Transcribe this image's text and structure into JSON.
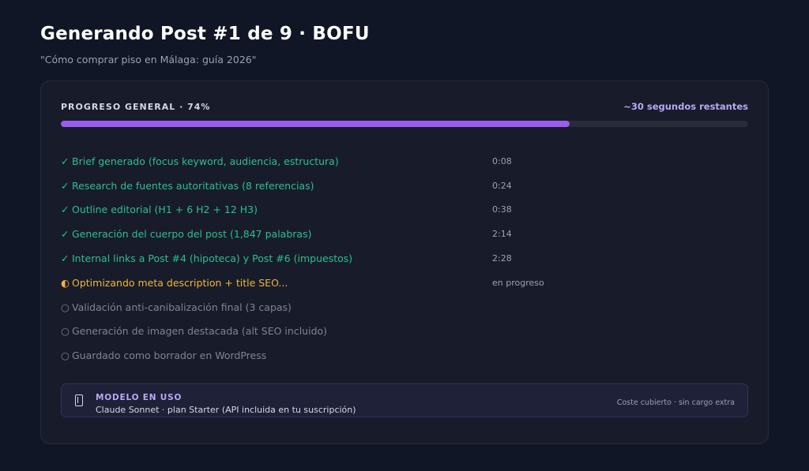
{
  "header": {
    "title": "Generando Post #1 de 9 · BOFU",
    "subtitle": "\"Cómo comprar piso en Málaga: guía 2026\""
  },
  "progress": {
    "label": "PROGRESO GENERAL · 74%",
    "percent": 74,
    "remaining": "~30 segundos restantes",
    "bar_color": "#9b5cf0"
  },
  "steps": [
    {
      "mark": "✓",
      "label": "Brief generado (focus keyword, audiencia, estructura)",
      "time": "0:08",
      "status": "done"
    },
    {
      "mark": "✓",
      "label": "Research de fuentes autoritativas (8 referencias)",
      "time": "0:24",
      "status": "done"
    },
    {
      "mark": "✓",
      "label": "Outline editorial (H1 + 6 H2 + 12 H3)",
      "time": "0:38",
      "status": "done"
    },
    {
      "mark": "✓",
      "label": "Generación del cuerpo del post (1,847 palabras)",
      "time": "2:14",
      "status": "done"
    },
    {
      "mark": "✓",
      "label": "Internal links a Post #4 (hipoteca) y Post #6 (impuestos)",
      "time": "2:28",
      "status": "done"
    },
    {
      "mark": "◐",
      "label": "Optimizando meta description + title SEO...",
      "time": "en progreso",
      "status": "active"
    },
    {
      "mark": "○",
      "label": "Validación anti-canibalización final (3 capas)",
      "time": "",
      "status": "pending"
    },
    {
      "mark": "○",
      "label": "Generación de imagen destacada (alt SEO incluido)",
      "time": "",
      "status": "pending"
    },
    {
      "mark": "○",
      "label": "Guardado como borrador en WordPress",
      "time": "",
      "status": "pending"
    }
  ],
  "model": {
    "icon": "phone-icon",
    "title": "MODELO EN USO",
    "description": "Claude Sonnet · plan Starter (API incluida en tu suscripción)",
    "cost": "Coste cubierto · sin cargo extra"
  }
}
